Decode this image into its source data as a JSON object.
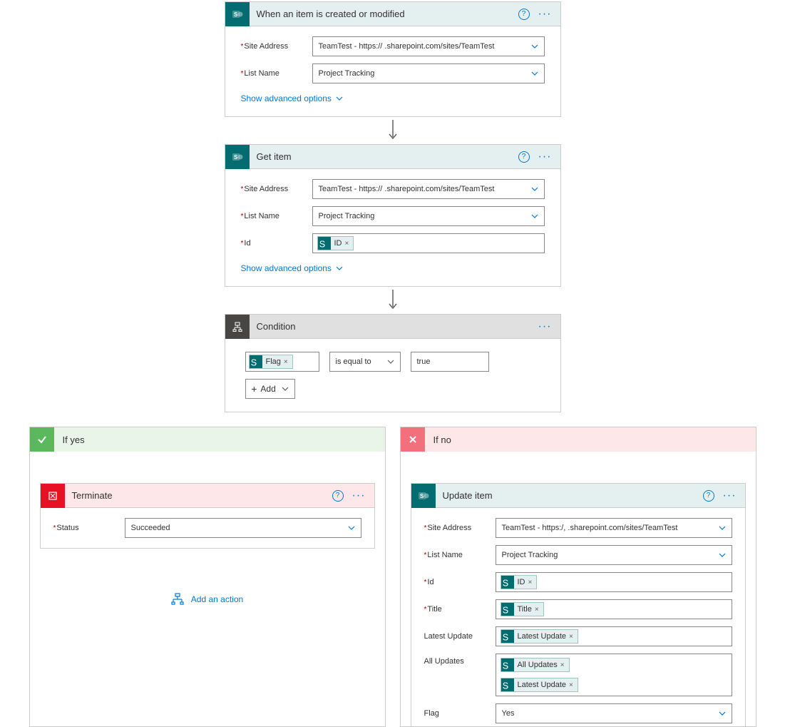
{
  "trigger": {
    "title": "When an item is created or modified",
    "fields": {
      "site_label": "Site Address",
      "site_value": "TeamTest - https://          .sharepoint.com/sites/TeamTest",
      "list_label": "List Name",
      "list_value": "Project Tracking"
    },
    "advanced": "Show advanced options"
  },
  "get_item": {
    "title": "Get item",
    "fields": {
      "site_label": "Site Address",
      "site_value": "TeamTest - https://          .sharepoint.com/sites/TeamTest",
      "list_label": "List Name",
      "list_value": "Project Tracking",
      "id_label": "Id",
      "id_token": "ID"
    },
    "advanced": "Show advanced options"
  },
  "condition": {
    "title": "Condition",
    "left_token": "Flag",
    "operator": "is equal to",
    "value": "true",
    "add_label": "Add"
  },
  "yes_branch": {
    "title": "If yes",
    "terminate": {
      "title": "Terminate",
      "status_label": "Status",
      "status_value": "Succeeded"
    },
    "add_action": "Add an action"
  },
  "no_branch": {
    "title": "If no",
    "update": {
      "title": "Update item",
      "site_label": "Site Address",
      "site_value": "TeamTest - https:/,            .sharepoint.com/sites/TeamTest",
      "list_label": "List Name",
      "list_value": "Project Tracking",
      "id_label": "Id",
      "id_token": "ID",
      "title_label": "Title",
      "title_token": "Title",
      "latest_label": "Latest Update",
      "latest_token": "Latest Update",
      "all_label": "All Updates",
      "all_token1": "All Updates",
      "all_token2": "Latest Update",
      "flag_label": "Flag",
      "flag_value": "Yes"
    }
  }
}
